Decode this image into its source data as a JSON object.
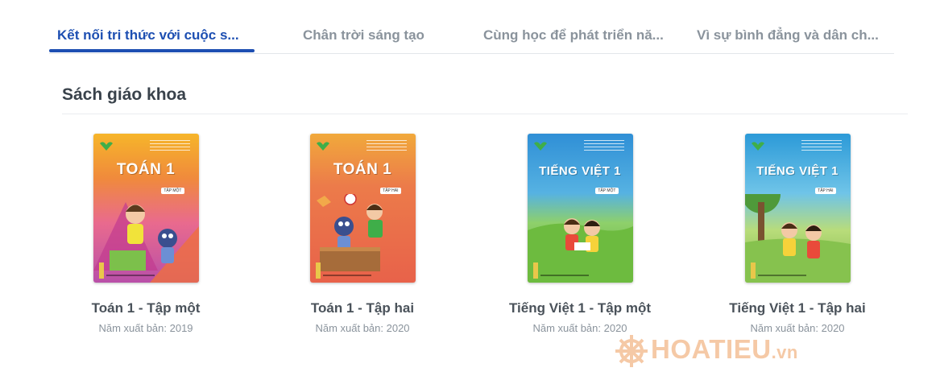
{
  "tabs": [
    {
      "label": "Kết nối tri thức với cuộc s...",
      "active": true
    },
    {
      "label": "Chân trời sáng tạo",
      "active": false
    },
    {
      "label": "Cùng học để phát triển nă...",
      "active": false
    },
    {
      "label": "Vì sự bình đẳng và dân ch...",
      "active": false
    }
  ],
  "section": {
    "title": "Sách giáo khoa"
  },
  "books": [
    {
      "title": "Toán 1 - Tập một",
      "year": "Năm xuất bản: 2019",
      "cover_title": "TOÁN 1",
      "cover_volume": "TẬP MỘT"
    },
    {
      "title": "Toán 1 - Tập hai",
      "year": "Năm xuất bản: 2020",
      "cover_title": "TOÁN 1",
      "cover_volume": "TẬP HAI"
    },
    {
      "title": "Tiếng Việt 1 - Tập một",
      "year": "Năm xuất bản: 2020",
      "cover_title": "TIẾNG VIỆT 1",
      "cover_volume": "TẬP MỘT"
    },
    {
      "title": "Tiếng Việt 1 - Tập hai",
      "year": "Năm xuất bản: 2020",
      "cover_title": "TIẾNG VIỆT 1",
      "cover_volume": "TẬP HAI"
    }
  ],
  "watermark": {
    "text": "HOATIEU",
    "suffix": ".vn",
    "icon": "ship-wheel-icon"
  },
  "colors": {
    "accent": "#1d4fb2",
    "muted": "#8a939c",
    "title": "#4a525a",
    "watermark": "#f5c9a6"
  }
}
